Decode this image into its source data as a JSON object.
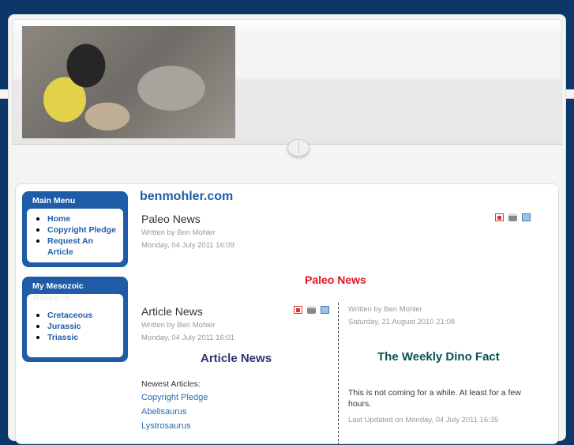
{
  "site_title": "benmohler.com",
  "main_menu": {
    "title": "Main Menu",
    "items": [
      "Home",
      "Copyright Pledge",
      "Request An Article"
    ]
  },
  "research_menu": {
    "title": "My Mesozoic",
    "title_overflow": "Research",
    "items": [
      "Cretaceous",
      "Jurassic",
      "Triassic"
    ]
  },
  "paleo": {
    "title": "Paleo News",
    "author": "Written by Ben Mohler",
    "date": "Monday, 04 July 2011 16:09",
    "heading": "Paleo News"
  },
  "article": {
    "title": "Article News",
    "author": "Written by Ben Mohler",
    "date": "Monday, 04 July 2011 16:01",
    "heading": "Article News",
    "newest_label": "Newest Articles:",
    "links": [
      "Copyright Pledge",
      "Abelisaurus",
      "Lystrosaurus"
    ]
  },
  "dino": {
    "author": "Written by Ben Mohler",
    "date": "Saturday, 21 August 2010 21:08",
    "heading": "The Weekly Dino Fact",
    "body": "This is not coming for a while. At least for a few hours.",
    "updated": "Last Updated on Monday, 04 July 2011 16:35"
  }
}
